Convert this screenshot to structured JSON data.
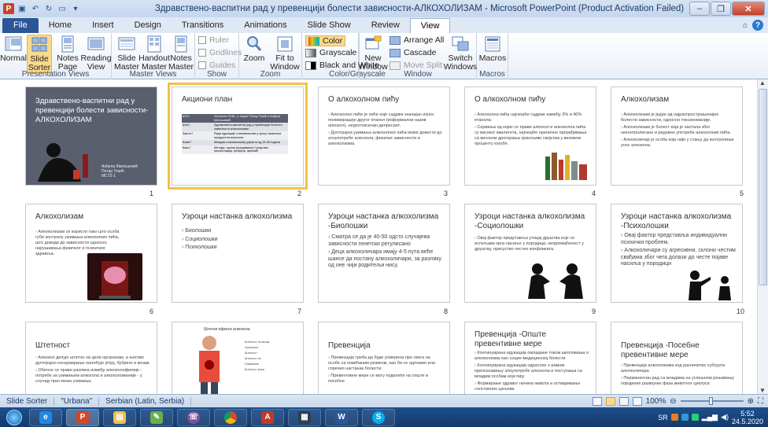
{
  "window": {
    "title": "Здравствено-васпитни рад у превенцији болести зависности-АЛКОХОЛИЗАМ - Microsoft PowerPoint (Product Activation Failed)",
    "minimize": "–",
    "maximize": "❐",
    "close": "✕"
  },
  "tabs": [
    "File",
    "Home",
    "Insert",
    "Design",
    "Transitions",
    "Animations",
    "Slide Show",
    "Review",
    "View"
  ],
  "active_tab": "View",
  "ribbon": {
    "presentation_views": {
      "label": "Presentation Views",
      "normal": "Normal",
      "slide_sorter": "Slide\nSorter",
      "notes_page": "Notes\nPage",
      "reading_view": "Reading\nView"
    },
    "master_views": {
      "label": "Master Views",
      "slide_master": "Slide\nMaster",
      "handout_master": "Handout\nMaster",
      "notes_master": "Notes\nMaster"
    },
    "show": {
      "label": "Show",
      "ruler": "Ruler",
      "gridlines": "Gridlines",
      "guides": "Guides"
    },
    "zoom": {
      "label": "Zoom",
      "zoom": "Zoom",
      "fit_to_window": "Fit to\nWindow"
    },
    "color_grayscale": {
      "label": "Color/Grayscale",
      "color": "Color",
      "grayscale": "Grayscale",
      "black_and_white": "Black and White"
    },
    "window": {
      "label": "Window",
      "new_window": "New\nWindow",
      "arrange_all": "Arrange All",
      "cascade": "Cascade",
      "move_split": "Move Split",
      "switch_windows": "Switch\nWindows"
    },
    "macros": {
      "label": "Macros",
      "macros": "Macros"
    }
  },
  "slides": [
    {
      "num": "1",
      "title": "Здравствено-васпитни рад у превенцији болести зависности-АЛКОХОЛИЗАМ",
      "footer": "Анђела Милошевић\nПетар Токић\nМСТ2-1"
    },
    {
      "num": "2",
      "title": "Акциони план",
      "rows": [
        [
          "ШТО",
          "Уклонити СНШ „з. алкри“ Петар Токић и Анђела Милошевић"
        ],
        [
          "Шта?",
          "Здравствено-васпитни рад у превенцији болести зависности-алкохолизам"
        ],
        [
          "Зашто?",
          "Ради едукације становништва у циљу смањења предузетна алкохола"
        ],
        [
          "Коме?",
          "Младим становништву узраста од 15-30 година"
        ],
        [
          "Како?",
          "Метода: групни (предавање) Средства: презентација, флајери, филмић"
        ]
      ]
    },
    {
      "num": "3",
      "title": "О алкохолном пићу",
      "body": [
        "Алкохолно пиће је пиће које садржи значајан износ полимерације другог етанол (информални назив алкохол), неуротоксичан депресант.",
        "Дуготрајна узимања алкохолних пића може довести до злоупотребе алкохола, физичке зависности и алкохолизма."
      ]
    },
    {
      "num": "4",
      "title": "О алкохолном пићу",
      "body": [
        "Алкохолна пића најчешће садрже између 3% и 40% етанола.",
        "Сервиња од којих се праве алкохол и алкохолна пића су високог квалитета, најчешће прилично прерађивања са високом дрогорања хранљиве својства у великом проценту изгубе."
      ]
    },
    {
      "num": "5",
      "title": "Алкохолизам",
      "body": [
        "Алкохолизам је један од најраспрострањенијих болести зависности, односно токсикоманије.",
        "Алкохолизам је болест која је настала због неконтролисане и редовне употребе алкохолних пића.",
        "Алкохоличар је особа која није у стању да контролише унос алкохола."
      ]
    },
    {
      "num": "6",
      "title": "Алкохолизам",
      "body": [
        "Алкохолизам се користи тако што особа губи контролу уживања алкохолних пића, што доводи до зависности односно нарушавања физичког и психичког здравља."
      ]
    },
    {
      "num": "7",
      "title": "Узроци настанка алкохолизма",
      "body": [
        "Биолошки",
        "Социолошки",
        "Психолошки"
      ]
    },
    {
      "num": "8",
      "title": "Узроци настанка алкохолизма -Биолошки",
      "body": [
        "Сматра се да је 40-50 одсто случајева зависности генетски регулисано",
        "Деца алкохоличара имају 4-5 пута веће шансе да постану алкохоличари, за разлику од оне чији родитељи нису."
      ]
    },
    {
      "num": "9",
      "title": "Узроци настанка алкохолизма -Социолошки",
      "body": [
        "Овај фактор представља утицај друштва које се испољава кроз насиље у породици, неприхваћеност у друштву, присуство честих конфликата."
      ]
    },
    {
      "num": "10",
      "title": "Узроци настанка алкохолизма -Психолошки",
      "body": [
        "Овај фактор представља индивидуални психички проблем.",
        "Алкохоличари су агресивни, склони честим свађама због чега долази до честе појаве насиља у породици"
      ]
    },
    {
      "num": "11",
      "title": "Штетност",
      "body": [
        "Алкохол делује штетно на цели организам, а његово дуготрајно конзумирање оштећује јетру, бубреге и мозак.",
        "Обично се прави разлика између алкохолофилије - потребе за узимањем алкохола и алкохоломаније - у случају престанка узимања."
      ]
    },
    {
      "num": "12",
      "title": "Штетни ефекти алкохола",
      "labels": [
        "Штетност по мозак",
        "Хроничног",
        "Штетност",
        "Штетност по",
        "Повишење",
        "Штетност јетре"
      ]
    },
    {
      "num": "13",
      "title": "Превенција",
      "body": [
        "Превенција треба да буде усмерена пре свега на особе са повећаним ризиком, као би се одложио или спречио настанак болести.",
        "Превентивне мере се могу поделити на опште и посебне"
      ]
    },
    {
      "num": "14",
      "title": "Превенција -Опште превентивне мере",
      "body": [
        "Континуирана едукација омладине током школовања о алкохолизму као социо-медицинској болести",
        "Континуирана едукација одраслих о рамом препознавању злоупотребе алкохола и поступања са младим особам који пију",
        "Формирање здравог начина живота и остваривање сопствених циљева"
      ]
    },
    {
      "num": "15",
      "title": "Превенција -Посебне превентивне мере",
      "body": [
        "Превенција алкохолизма код различитих субгрупа алкохоличара",
        "Перманентан рад са младима на успешном решавању појединих развојних фаза животног циклуса"
      ]
    }
  ],
  "status": {
    "view": "Slide Sorter",
    "theme": "\"Urbana\"",
    "language": "Serbian (Latin, Serbia)",
    "zoom": "100%"
  },
  "taskbar": {
    "lang": "SR",
    "time": "5:52",
    "date": "24.5.2020"
  }
}
